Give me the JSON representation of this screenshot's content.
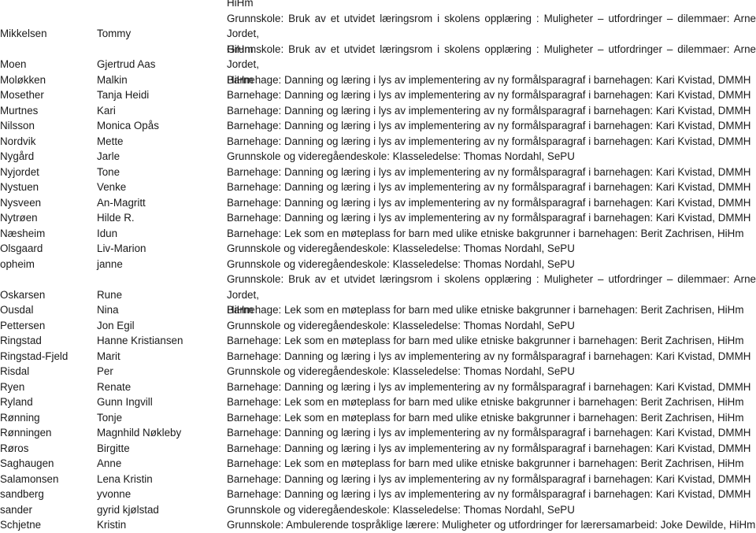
{
  "continued_from_previous": "HiHm",
  "courses": {
    "grunnskole_utvidet": "Grunnskole: Bruk av et utvidet læringsrom i skolens opplæring : Muligheter – utfordringer – dilemmaer: Arne Jordet,",
    "grunnskole_utvidet_cont": "HiHm",
    "barnehage_danning": "Barnehage: Danning og læring i lys av implementering av ny formålsparagraf i barnehagen: Kari Kvistad, DMMH",
    "barnehage_lek": "Barnehage: Lek som en møteplass for barn med ulike etniske bakgrunner i barnehagen: Berit Zachrisen, HiHm",
    "klasseledelse": "Grunnskole og videregåendeskole: Klasseledelse: Thomas Nordahl, SePU",
    "ambulerende": "Grunnskole: Ambulerende tospråklige lærere: Muligheter og utfordringer for lærersamarbeid: Joke Dewilde, HiHm"
  },
  "rows": [
    {
      "last": "Mikkelsen",
      "first": "Tommy",
      "course_line1": "Grunnskole: Bruk av et utvidet læringsrom i skolens opplæring : Muligheter – utfordringer – dilemmaer: Arne Jordet,",
      "course_line2": "HiHm"
    },
    {
      "last": "Moen",
      "first": "Gjertrud Aas",
      "course_line1": "Grunnskole: Bruk av et utvidet læringsrom i skolens opplæring : Muligheter – utfordringer – dilemmaer: Arne Jordet,",
      "course_line2": "HiHm"
    },
    {
      "last": "Moløkken",
      "first": "Malkin",
      "course": "Barnehage: Danning og læring i lys av implementering av ny formålsparagraf i barnehagen: Kari Kvistad, DMMH"
    },
    {
      "last": "Mosether",
      "first": "Tanja Heidi",
      "course": "Barnehage: Danning og læring i lys av implementering av ny formålsparagraf i barnehagen: Kari Kvistad, DMMH"
    },
    {
      "last": "Murtnes",
      "first": "Kari",
      "course": "Barnehage: Danning og læring i lys av implementering av ny formålsparagraf i barnehagen: Kari Kvistad, DMMH"
    },
    {
      "last": "Nilsson",
      "first": "Monica Opås",
      "course": "Barnehage: Danning og læring i lys av implementering av ny formålsparagraf i barnehagen: Kari Kvistad, DMMH"
    },
    {
      "last": "Nordvik",
      "first": "Mette",
      "course": "Barnehage: Danning og læring i lys av implementering av ny formålsparagraf i barnehagen: Kari Kvistad, DMMH"
    },
    {
      "last": "Nygård",
      "first": "Jarle",
      "course": "Grunnskole og videregåendeskole: Klasseledelse: Thomas Nordahl, SePU"
    },
    {
      "last": "Nyjordet",
      "first": "Tone",
      "course": "Barnehage: Danning og læring i lys av implementering av ny formålsparagraf i barnehagen: Kari Kvistad, DMMH"
    },
    {
      "last": "Nystuen",
      "first": "Venke",
      "course": "Barnehage: Danning og læring i lys av implementering av ny formålsparagraf i barnehagen: Kari Kvistad, DMMH"
    },
    {
      "last": "Nysveen",
      "first": "An-Magritt",
      "course": "Barnehage: Danning og læring i lys av implementering av ny formålsparagraf i barnehagen: Kari Kvistad, DMMH"
    },
    {
      "last": "Nytrøen",
      "first": "Hilde R.",
      "course": "Barnehage: Danning og læring i lys av implementering av ny formålsparagraf i barnehagen: Kari Kvistad, DMMH"
    },
    {
      "last": "Næsheim",
      "first": "Idun",
      "course": "Barnehage: Lek som en møteplass for barn med ulike etniske bakgrunner i barnehagen: Berit Zachrisen, HiHm"
    },
    {
      "last": "Olsgaard",
      "first": "Liv-Marion",
      "course": "Grunnskole og videregåendeskole: Klasseledelse: Thomas Nordahl, SePU"
    },
    {
      "last": "opheim",
      "first": "janne",
      "course": "Grunnskole og videregåendeskole: Klasseledelse: Thomas Nordahl, SePU"
    },
    {
      "last": "Oskarsen",
      "first": "Rune",
      "course_line1": "Grunnskole: Bruk av et utvidet læringsrom i skolens opplæring : Muligheter – utfordringer – dilemmaer: Arne Jordet,",
      "course_line2": "HiHm"
    },
    {
      "last": "Ousdal",
      "first": "Nina",
      "course": "Barnehage: Lek som en møteplass for barn med ulike etniske bakgrunner i barnehagen: Berit Zachrisen, HiHm"
    },
    {
      "last": "Pettersen",
      "first": "Jon Egil",
      "course": "Grunnskole og videregåendeskole: Klasseledelse: Thomas Nordahl, SePU"
    },
    {
      "last": "Ringstad",
      "first": "Hanne Kristiansen",
      "course": "Barnehage: Lek som en møteplass for barn med ulike etniske bakgrunner i barnehagen: Berit Zachrisen, HiHm"
    },
    {
      "last": "Ringstad-Fjeld",
      "first": "Marit",
      "course": "Barnehage: Danning og læring i lys av implementering av ny formålsparagraf i barnehagen: Kari Kvistad, DMMH"
    },
    {
      "last": "Risdal",
      "first": "Per",
      "course": "Grunnskole og videregåendeskole: Klasseledelse: Thomas Nordahl, SePU"
    },
    {
      "last": "Ryen",
      "first": "Renate",
      "course": "Barnehage: Danning og læring i lys av implementering av ny formålsparagraf i barnehagen: Kari Kvistad, DMMH"
    },
    {
      "last": "Ryland",
      "first": "Gunn Ingvill",
      "course": "Barnehage: Lek som en møteplass for barn med ulike etniske bakgrunner i barnehagen: Berit Zachrisen, HiHm"
    },
    {
      "last": "Rønning",
      "first": "Tonje",
      "course": "Barnehage: Lek som en møteplass for barn med ulike etniske bakgrunner i barnehagen: Berit Zachrisen, HiHm"
    },
    {
      "last": "Rønningen",
      "first": "Magnhild Nøkleby",
      "course": "Barnehage: Danning og læring i lys av implementering av ny formålsparagraf i barnehagen: Kari Kvistad, DMMH"
    },
    {
      "last": "Røros",
      "first": "Birgitte",
      "course": "Barnehage: Danning og læring i lys av implementering av ny formålsparagraf i barnehagen: Kari Kvistad, DMMH"
    },
    {
      "last": "Saghaugen",
      "first": "Anne",
      "course": "Barnehage: Lek som en møteplass for barn med ulike etniske bakgrunner i barnehagen: Berit Zachrisen, HiHm"
    },
    {
      "last": "Salamonsen",
      "first": "Lena Kristin",
      "course": "Barnehage: Danning og læring i lys av implementering av ny formålsparagraf i barnehagen: Kari Kvistad, DMMH"
    },
    {
      "last": "sandberg",
      "first": "yvonne",
      "course": "Barnehage: Danning og læring i lys av implementering av ny formålsparagraf i barnehagen: Kari Kvistad, DMMH"
    },
    {
      "last": "sander",
      "first": "gyrid kjølstad",
      "course": "Grunnskole og videregåendeskole: Klasseledelse: Thomas Nordahl, SePU"
    },
    {
      "last": "Schjetne",
      "first": "Kristin",
      "course": "Grunnskole: Ambulerende tospråklige lærere: Muligheter og utfordringer for lærersamarbeid: Joke Dewilde, HiHm"
    }
  ]
}
